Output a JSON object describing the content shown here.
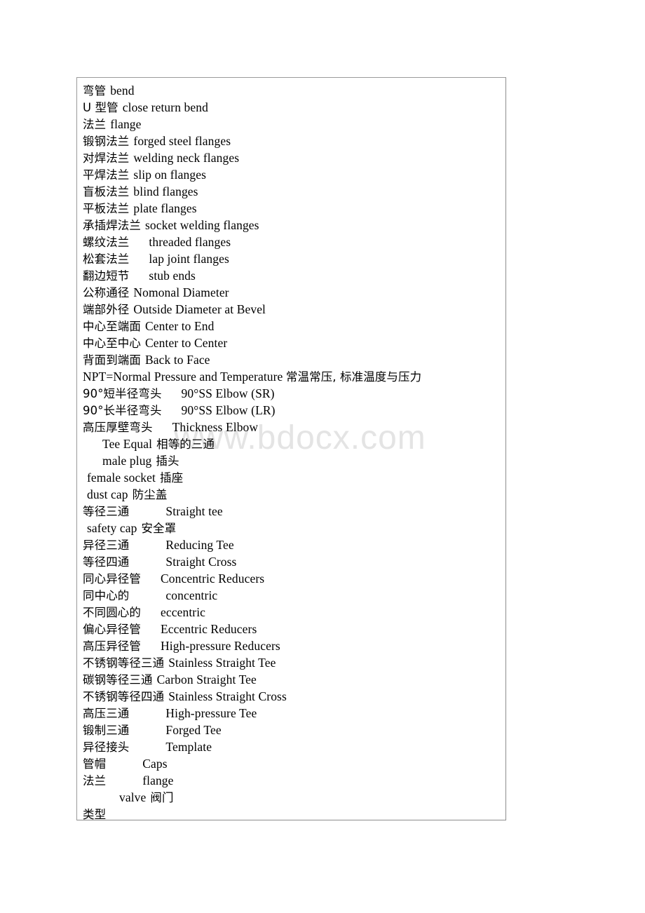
{
  "document": {
    "watermark": "www.bdocx.com",
    "page_background": "#ffffff",
    "table": {
      "border_color": "#9a9a9a",
      "rows": [
        {
          "zh": "弯管",
          "gap": "sm",
          "en": "bend"
        },
        {
          "zh": "U 型管",
          "gap": "sm",
          "en": "close return bend"
        },
        {
          "zh": "法兰",
          "gap": "sm",
          "en": "flange"
        },
        {
          "zh": "锻钢法兰",
          "gap": "sm",
          "en": "forged steel flanges"
        },
        {
          "zh": "对焊法兰",
          "gap": "sm",
          "en": "welding neck flanges"
        },
        {
          "zh": "平焊法兰",
          "gap": "sm",
          "en": "slip on flanges"
        },
        {
          "zh": "盲板法兰",
          "gap": "sm",
          "en": "blind flanges"
        },
        {
          "zh": "平板法兰",
          "gap": "sm",
          "en": "plate flanges"
        },
        {
          "zh": "承插焊法兰",
          "gap": "sm",
          "en": "socket welding flanges"
        },
        {
          "zh": "螺纹法兰",
          "gap": "md",
          "en": "threaded flanges"
        },
        {
          "zh": "松套法兰",
          "gap": "md",
          "en": "lap joint flanges"
        },
        {
          "zh": "翻边短节",
          "gap": "md",
          "en": "stub ends"
        },
        {
          "zh": "公称通径",
          "gap": "sm",
          "en": "Nomonal Diameter"
        },
        {
          "zh": "端部外径",
          "gap": "sm",
          "en": "Outside Diameter at Bevel"
        },
        {
          "zh": "中心至端面",
          "gap": "sm",
          "en": "Center to End"
        },
        {
          "zh": "中心至中心",
          "gap": "sm",
          "en": "Center to Center"
        },
        {
          "zh": "背面到端面",
          "gap": "sm",
          "en": "Back to Face"
        },
        {
          "zh": "",
          "gap": "none",
          "en": "NPT=Normal Pressure and Temperature ",
          "zh_tail": "常温常压, 标准温度与压力"
        },
        {
          "zh": "90°短半径弯头",
          "gap": "md",
          "en": "90°SS Elbow (SR)"
        },
        {
          "zh": "90°长半径弯头",
          "gap": "md",
          "en": "90°SS Elbow (LR)"
        },
        {
          "zh": "高压厚壁弯头",
          "gap": "md",
          "en": "Thickness Elbow"
        },
        {
          "zh": "",
          "gap": "md",
          "en": "Tee Equal",
          "zh_tail": "相等的三通"
        },
        {
          "zh": "",
          "gap": "md",
          "en": "male plug",
          "zh_tail": "插头"
        },
        {
          "zh": "",
          "gap": "sm",
          "en": "female socket",
          "zh_tail": "插座"
        },
        {
          "zh": "",
          "gap": "sm",
          "en": "dust cap",
          "zh_tail": "防尘盖"
        },
        {
          "zh": "等径三通",
          "gap": "lg",
          "en": "Straight tee"
        },
        {
          "zh": "",
          "gap": "sm",
          "en": "safety cap",
          "zh_tail": "安全罩"
        },
        {
          "zh": "异径三通",
          "gap": "lg",
          "en": "Reducing Tee"
        },
        {
          "zh": "等径四通",
          "gap": "lg",
          "en": "Straight Cross"
        },
        {
          "zh": "同心异径管",
          "gap": "md",
          "en": "Concentric Reducers"
        },
        {
          "zh": "同中心的",
          "gap": "lg",
          "en": "concentric"
        },
        {
          "zh": "不同圆心的",
          "gap": "md",
          "en": "eccentric"
        },
        {
          "zh": "偏心异径管",
          "gap": "md",
          "en": "Eccentric Reducers"
        },
        {
          "zh": "高压异径管",
          "gap": "md",
          "en": "High-pressure Reducers"
        },
        {
          "zh": "不锈钢等径三通",
          "gap": "sm",
          "en": "Stainless Straight Tee"
        },
        {
          "zh": "碳钢等径三通",
          "gap": "sm",
          "en": "Carbon Straight Tee"
        },
        {
          "zh": "不锈钢等径四通",
          "gap": "sm",
          "en": "Stainless Straight Cross"
        },
        {
          "zh": "高压三通",
          "gap": "lg",
          "en": "High-pressure Tee"
        },
        {
          "zh": "锻制三通",
          "gap": "lg",
          "en": "Forged Tee"
        },
        {
          "zh": "异径接头",
          "gap": "lg",
          "en": "Template"
        },
        {
          "zh": "管帽",
          "gap": "lg",
          "en": "Caps"
        },
        {
          "zh": "法兰",
          "gap": "lg",
          "en": "flange"
        },
        {
          "zh": "",
          "gap": "lg",
          "en": "valve",
          "zh_tail": "阀门"
        },
        {
          "zh": "类型",
          "gap": "none",
          "en": ""
        }
      ]
    }
  }
}
